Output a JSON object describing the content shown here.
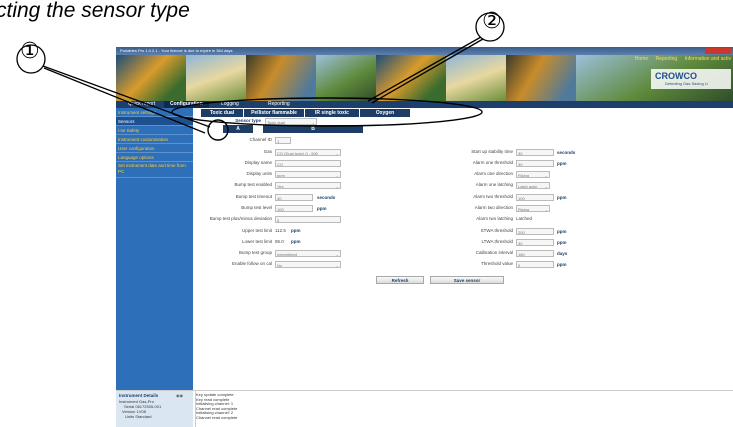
{
  "caption": "cting the sensor type",
  "callouts": [
    "①",
    "②"
  ],
  "window": {
    "title": "Portables Pro 1.0.2.1 - Your licence is due to expire in 364 days"
  },
  "banner": {
    "links": [
      "Home",
      "Reporting",
      "Information and activ"
    ],
    "logo_brand": "CROWCO",
    "logo_sub": "Detecting Gas Saving Li"
  },
  "nav": {
    "items": [
      "Quick report",
      "Configuration",
      "Logging",
      "Reporting"
    ]
  },
  "sidebar": {
    "items": [
      "Instrument settings",
      "Sensors",
      "i-se Safety",
      "Instrument customisation",
      "User configuration",
      "Language options",
      "Set instrument date and time from PC"
    ]
  },
  "sensor_tabs": [
    "Toxic dual",
    "Pellistor flammable",
    "IR single toxic",
    "Oxygen"
  ],
  "sensor_type": {
    "label": "Sensor type",
    "value": "Toxic dual"
  },
  "channel_tabs": [
    "A",
    "B"
  ],
  "left_fields": [
    {
      "label": "Channel ID",
      "value": "1"
    },
    {
      "label": "Gas",
      "value": "CO (Dual toxic) 0 - 500"
    },
    {
      "label": "Display name",
      "value": "CO"
    },
    {
      "label": "Display units",
      "value": "ppm"
    },
    {
      "label": "Bump test enabled",
      "value": "Yes"
    },
    {
      "label": "Bump test timeout",
      "value": "40",
      "unit": "seconds"
    },
    {
      "label": "Bump test level",
      "value": "100",
      "unit": "ppm"
    },
    {
      "label": "Bump test plus/minus deviation",
      "value": "5"
    },
    {
      "label": "Upper test limit",
      "value": "112.5",
      "unit": "ppm"
    },
    {
      "label": "Lower test limit",
      "value": "95.0",
      "unit": "ppm"
    },
    {
      "label": "Bump test group",
      "value": "Intermittent"
    },
    {
      "label": "Enable follow on cal",
      "value": "No"
    }
  ],
  "right_fields": [
    {
      "label": "Start up stability time",
      "value": "30",
      "unit": "seconds"
    },
    {
      "label": "Alarm one threshold",
      "value": "30",
      "unit": "ppm"
    },
    {
      "label": "Alarm one direction",
      "value": "Rising"
    },
    {
      "label": "Alarm one latching",
      "value": "Latch ackn"
    },
    {
      "label": "Alarm two threshold",
      "value": "100",
      "unit": "ppm"
    },
    {
      "label": "Alarm two direction",
      "value": "Rising"
    },
    {
      "label": "Alarm two latching",
      "value": "Latched"
    },
    {
      "label": "STWA threshold",
      "value": "200",
      "unit": "ppm"
    },
    {
      "label": "LTWA threshold",
      "value": "30",
      "unit": "ppm"
    },
    {
      "label": "Calibration interval",
      "value": "180",
      "unit": "days"
    },
    {
      "label": "Threshold value",
      "value": "0",
      "unit": "ppm"
    }
  ],
  "buttons": {
    "refresh": "Refresh",
    "save": "Save sensor"
  },
  "instrument_details": {
    "title": "Instrument Details",
    "rows": [
      {
        "k": "Instrument",
        "v": "Gas-Pro"
      },
      {
        "k": "Serial",
        "v": "06172505-001"
      },
      {
        "k": "Version",
        "v": "1V08"
      },
      {
        "k": "Units",
        "v": "Standard"
      }
    ]
  },
  "log_lines": [
    "Key update complete",
    "Key read complete",
    "Initialising channel: 1",
    "Channel read complete",
    "Initialising channel: 2",
    "Channel read complete"
  ],
  "colors": {
    "nav": "#1c3f6e",
    "sidebar": "#2d6fb8",
    "sidebar_text": "#ffcc33",
    "tab": "#1e3d66"
  }
}
